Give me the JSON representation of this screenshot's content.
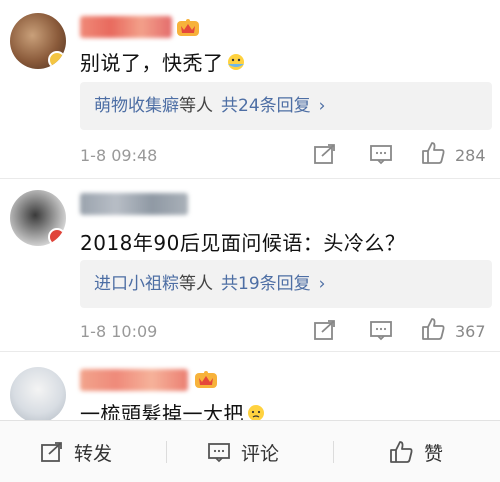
{
  "comments": [
    {
      "text": "别说了，快秃了",
      "emoji": "smiling-face-emoji",
      "reply_names": "萌物收集癖",
      "reply_etc": "等人",
      "reply_count": "共24条回复",
      "time": "1-8 09:48",
      "likes": "284"
    },
    {
      "text": "2018年90后见面问候语：头冷么？",
      "reply_names": "进口小祖粽",
      "reply_etc": "等人",
      "reply_count": "共19条回复",
      "time": "1-8 10:09",
      "likes": "367"
    },
    {
      "text": "一梳頭髮掉一大把",
      "emoji": "cold-sweat-emoji"
    }
  ],
  "icons": {
    "chevron": "›",
    "repost": "repost-icon",
    "comment": "comment-icon",
    "like": "thumbs-up-icon"
  },
  "bottom_bar": {
    "repost_label": "转发",
    "comment_label": "评论",
    "like_label": "赞"
  },
  "colors": {
    "link_blue": "#4d6ea4",
    "reply_bg": "#f2f2f2",
    "meta_gray": "#999999"
  }
}
